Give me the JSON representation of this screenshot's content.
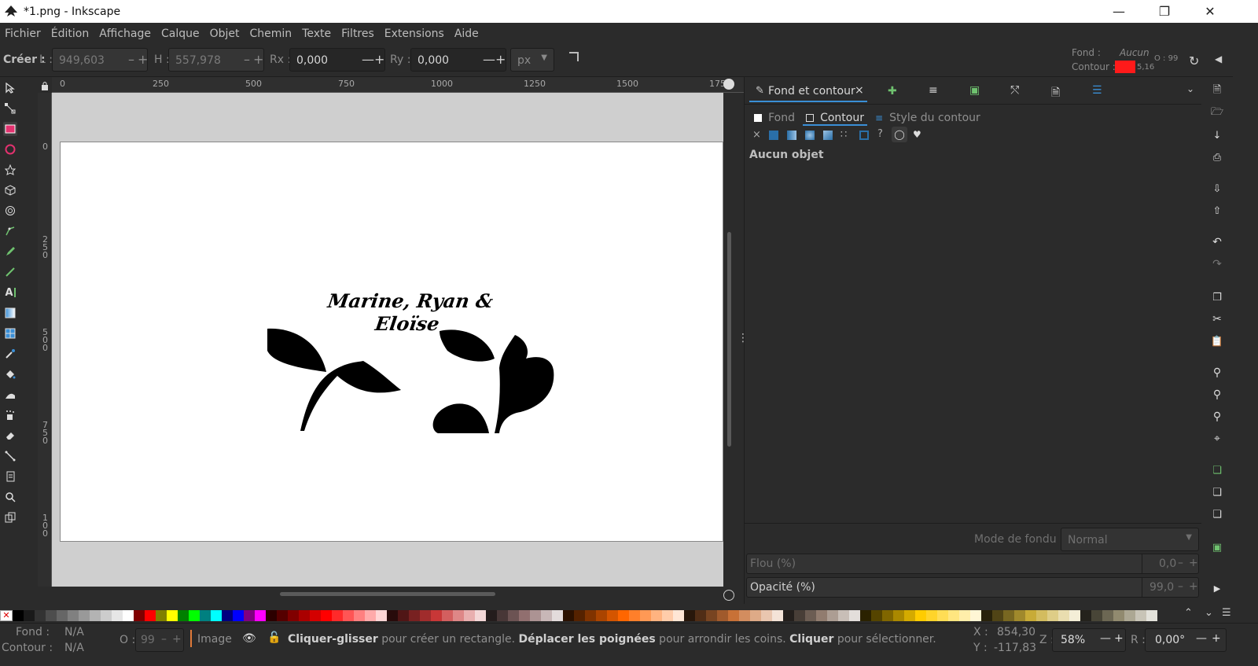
{
  "window": {
    "title": "*1.png - Inkscape"
  },
  "menu": [
    "Fichier",
    "Édition",
    "Affichage",
    "Calque",
    "Objet",
    "Chemin",
    "Texte",
    "Filtres",
    "Extensions",
    "Aide"
  ],
  "toolctl": {
    "creer": "Créer :",
    "l_label": "L :",
    "l_value": "949,603",
    "h_label": "H :",
    "h_value": "557,978",
    "rx_label": "Rx :",
    "rx_value": "0,000",
    "ry_label": "Ry :",
    "ry_value": "0,000",
    "unit": "px",
    "fond_label": "Fond :",
    "fond_value": "Aucun",
    "contour_label": "Contour :",
    "contour_width": "5,16",
    "contour_color": "#ff1a1a",
    "opacity_short": "O : 99"
  },
  "ruler": {
    "h_ticks": [
      "0",
      "250",
      "500",
      "750",
      "1000",
      "1250",
      "1500",
      "175"
    ],
    "v_ticks": [
      "0",
      "2 5 0",
      "5 0 0",
      "7 5 0",
      "1 0 0"
    ]
  },
  "canvas": {
    "artwork_caption": "Marine, Ryan & Eloïse"
  },
  "panel": {
    "tab_title": "Fond et contour",
    "sub_tabs": [
      "Fond",
      "Contour",
      "Style du contour"
    ],
    "no_object": "Aucun objet",
    "blend_label": "Mode de fondu :",
    "blend_value": "Normal",
    "blur_label": "Flou (%)",
    "blur_value": "0,0",
    "opacity_label": "Opacité (%)",
    "opacity_value": "99,0"
  },
  "status": {
    "fond_label": "Fond :",
    "fond_value": "N/A",
    "contour_label": "Contour :",
    "contour_value": "N/A",
    "o_label": "O :",
    "o_value": "99",
    "layer": "Image",
    "msg_b1": "Cliquer-glisser",
    "msg_t1": " pour créer un rectangle. ",
    "msg_b2": "Déplacer les poignées",
    "msg_t2": " pour arrondir les coins. ",
    "msg_b3": "Cliquer",
    "msg_t3": " pour sélectionner.",
    "x_label": "X :",
    "x_value": "854,30",
    "y_label": "Y :",
    "y_value": "-117,83",
    "z_label": "Z :",
    "zoom": "58%",
    "r_label": "R :",
    "rotation": "0,00°"
  },
  "palette_colors": [
    "#000000",
    "#1a1a1a",
    "#333333",
    "#4d4d4d",
    "#666666",
    "#808080",
    "#999999",
    "#b3b3b3",
    "#cccccc",
    "#e6e6e6",
    "#ffffff",
    "#800000",
    "#ff0000",
    "#808000",
    "#ffff00",
    "#008000",
    "#00ff00",
    "#008080",
    "#00ffff",
    "#000080",
    "#0000ff",
    "#800080",
    "#ff00ff",
    "#2b0000",
    "#550000",
    "#800000",
    "#aa0000",
    "#d40000",
    "#ff0000",
    "#ff2a2a",
    "#ff5555",
    "#ff8080",
    "#ffaaaa",
    "#ffd5d5",
    "#280b0b",
    "#501616",
    "#782121",
    "#a02c2c",
    "#c83737",
    "#d35f5f",
    "#de8787",
    "#e9afaf",
    "#f4d7d7",
    "#241c1c",
    "#483737",
    "#6c5353",
    "#916f6f",
    "#ac9393",
    "#c8b7b7",
    "#e3dbdb",
    "#2b1100",
    "#552200",
    "#803300",
    "#aa4400",
    "#d45500",
    "#ff6600",
    "#ff7f2a",
    "#ff9955",
    "#ffb380",
    "#ffccaa",
    "#ffe6d5",
    "#28170b",
    "#502d16",
    "#784421",
    "#a05a2c",
    "#c87137",
    "#d38d5f",
    "#deaa87",
    "#e9c6af",
    "#f4e3d7",
    "#241f1c",
    "#483e37",
    "#6c5d53",
    "#917c6f",
    "#ac9d93",
    "#c8beb7",
    "#e3dedb",
    "#2b2200",
    "#554400",
    "#806600",
    "#aa8800",
    "#d4aa00",
    "#ffcc00",
    "#ffd42a",
    "#ffdd55",
    "#ffe680",
    "#ffeeaa",
    "#fff6d5",
    "#28220b",
    "#504416",
    "#786721",
    "#a0892c",
    "#c8ab37",
    "#d3bc5f",
    "#decd87",
    "#e9ddaf",
    "#f4eed7",
    "#24221c",
    "#484537",
    "#6c6753",
    "#918a6f",
    "#aca793",
    "#c8c4b7",
    "#e3e2db"
  ]
}
